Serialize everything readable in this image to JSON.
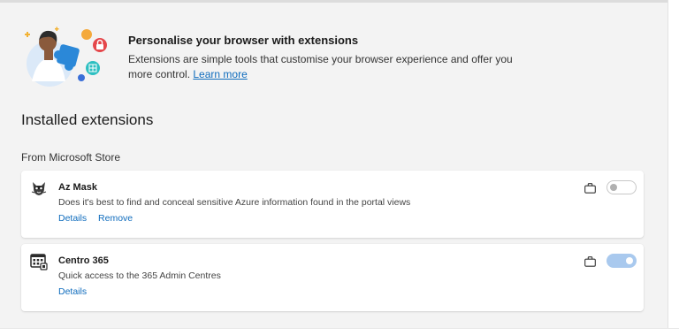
{
  "hero": {
    "title": "Personalise your browser with extensions",
    "description": "Extensions are simple tools that customise your browser experience and offer you more control.",
    "learn_more": "Learn more"
  },
  "installed": {
    "heading": "Installed extensions",
    "source_label": "From Microsoft Store"
  },
  "extensions": [
    {
      "name": "Az Mask",
      "description": "Does it's best to find and conceal sensitive Azure information found in the portal views",
      "details_label": "Details",
      "remove_label": "Remove",
      "enabled": false,
      "icon": "raccoon-mask-icon"
    },
    {
      "name": "Centro 365",
      "description": "Quick access to the 365 Admin Centres",
      "details_label": "Details",
      "enabled": true,
      "icon": "app-grid-icon"
    }
  ],
  "colors": {
    "link": "#0f6cbd",
    "toggle_on": "#a9c9ee",
    "background": "#f3f3f3"
  }
}
